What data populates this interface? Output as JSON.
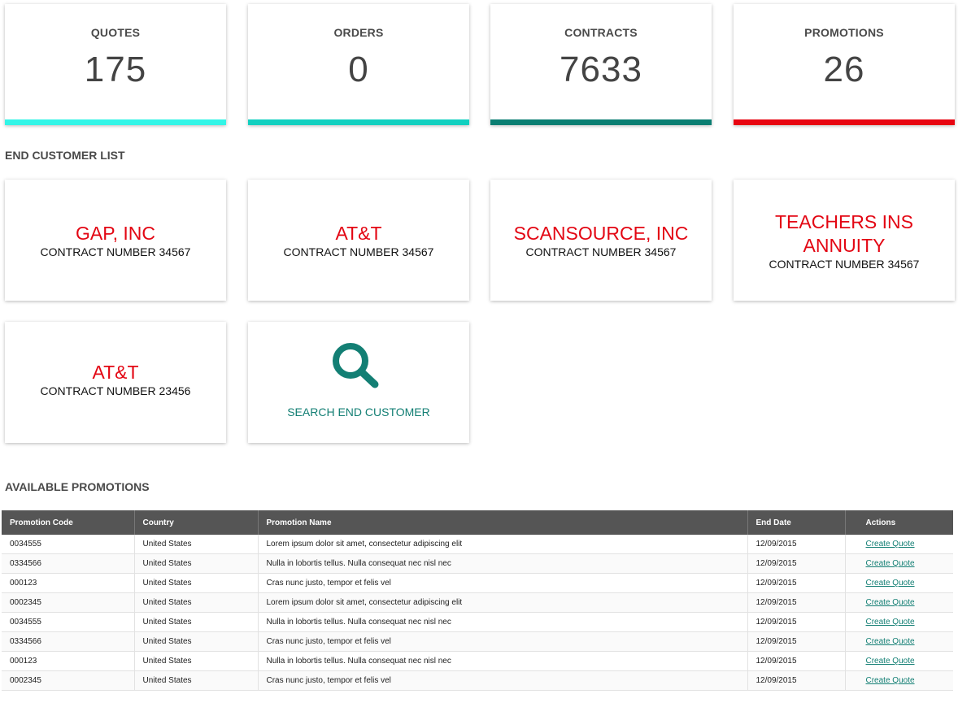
{
  "stats": [
    {
      "label": "QUOTES",
      "value": "175",
      "color": "#33f5e7"
    },
    {
      "label": "ORDERS",
      "value": "0",
      "color": "#12d0c0"
    },
    {
      "label": "CONTRACTS",
      "value": "7633",
      "color": "#0a7e72"
    },
    {
      "label": "PROMOTIONS",
      "value": "26",
      "color": "#e80511"
    }
  ],
  "end_customer_section": {
    "title": "END CUSTOMER LIST"
  },
  "customers": [
    {
      "name": "GAP, INC",
      "contract": "CONTRACT NUMBER 34567"
    },
    {
      "name": "AT&T",
      "contract": "CONTRACT NUMBER 34567"
    },
    {
      "name": "SCANSOURCE, INC",
      "contract": "CONTRACT NUMBER 34567"
    },
    {
      "name": "TEACHERS INS ANNUITY",
      "contract": "CONTRACT NUMBER 34567"
    },
    {
      "name": "AT&T",
      "contract": "CONTRACT NUMBER 23456"
    }
  ],
  "search": {
    "label": "SEARCH END CUSTOMER",
    "icon": "search-icon",
    "color": "#137f74"
  },
  "promotions_section": {
    "title": "AVAILABLE PROMOTIONS"
  },
  "promotions_table": {
    "headers": [
      "Promotion Code",
      "Country",
      "Promotion Name",
      "End Date",
      "Actions"
    ],
    "rows": [
      {
        "code": "0034555",
        "country": "United States",
        "name": "Lorem ipsum dolor sit amet, consectetur adipiscing elit",
        "end_date": "12/09/2015",
        "action": "Create Quote"
      },
      {
        "code": "0334566",
        "country": "United States",
        "name": "Nulla in lobortis tellus. Nulla consequat nec nisl nec",
        "end_date": "12/09/2015",
        "action": "Create Quote"
      },
      {
        "code": "000123",
        "country": "United States",
        "name": "Cras nunc justo, tempor et felis vel",
        "end_date": "12/09/2015",
        "action": "Create Quote"
      },
      {
        "code": "0002345",
        "country": "United States",
        "name": "Lorem ipsum dolor sit amet, consectetur adipiscing elit",
        "end_date": "12/09/2015",
        "action": "Create Quote"
      },
      {
        "code": "0034555",
        "country": "United States",
        "name": "Nulla in lobortis tellus. Nulla consequat nec nisl nec",
        "end_date": "12/09/2015",
        "action": "Create Quote"
      },
      {
        "code": "0334566",
        "country": "United States",
        "name": "Cras nunc justo, tempor et felis vel",
        "end_date": "12/09/2015",
        "action": "Create Quote"
      },
      {
        "code": "000123",
        "country": "United States",
        "name": "Nulla in lobortis tellus. Nulla consequat nec nisl nec",
        "end_date": "12/09/2015",
        "action": "Create Quote"
      },
      {
        "code": "0002345",
        "country": "United States",
        "name": "Cras nunc justo, tempor et felis vel",
        "end_date": "12/09/2015",
        "action": "Create Quote"
      }
    ]
  }
}
